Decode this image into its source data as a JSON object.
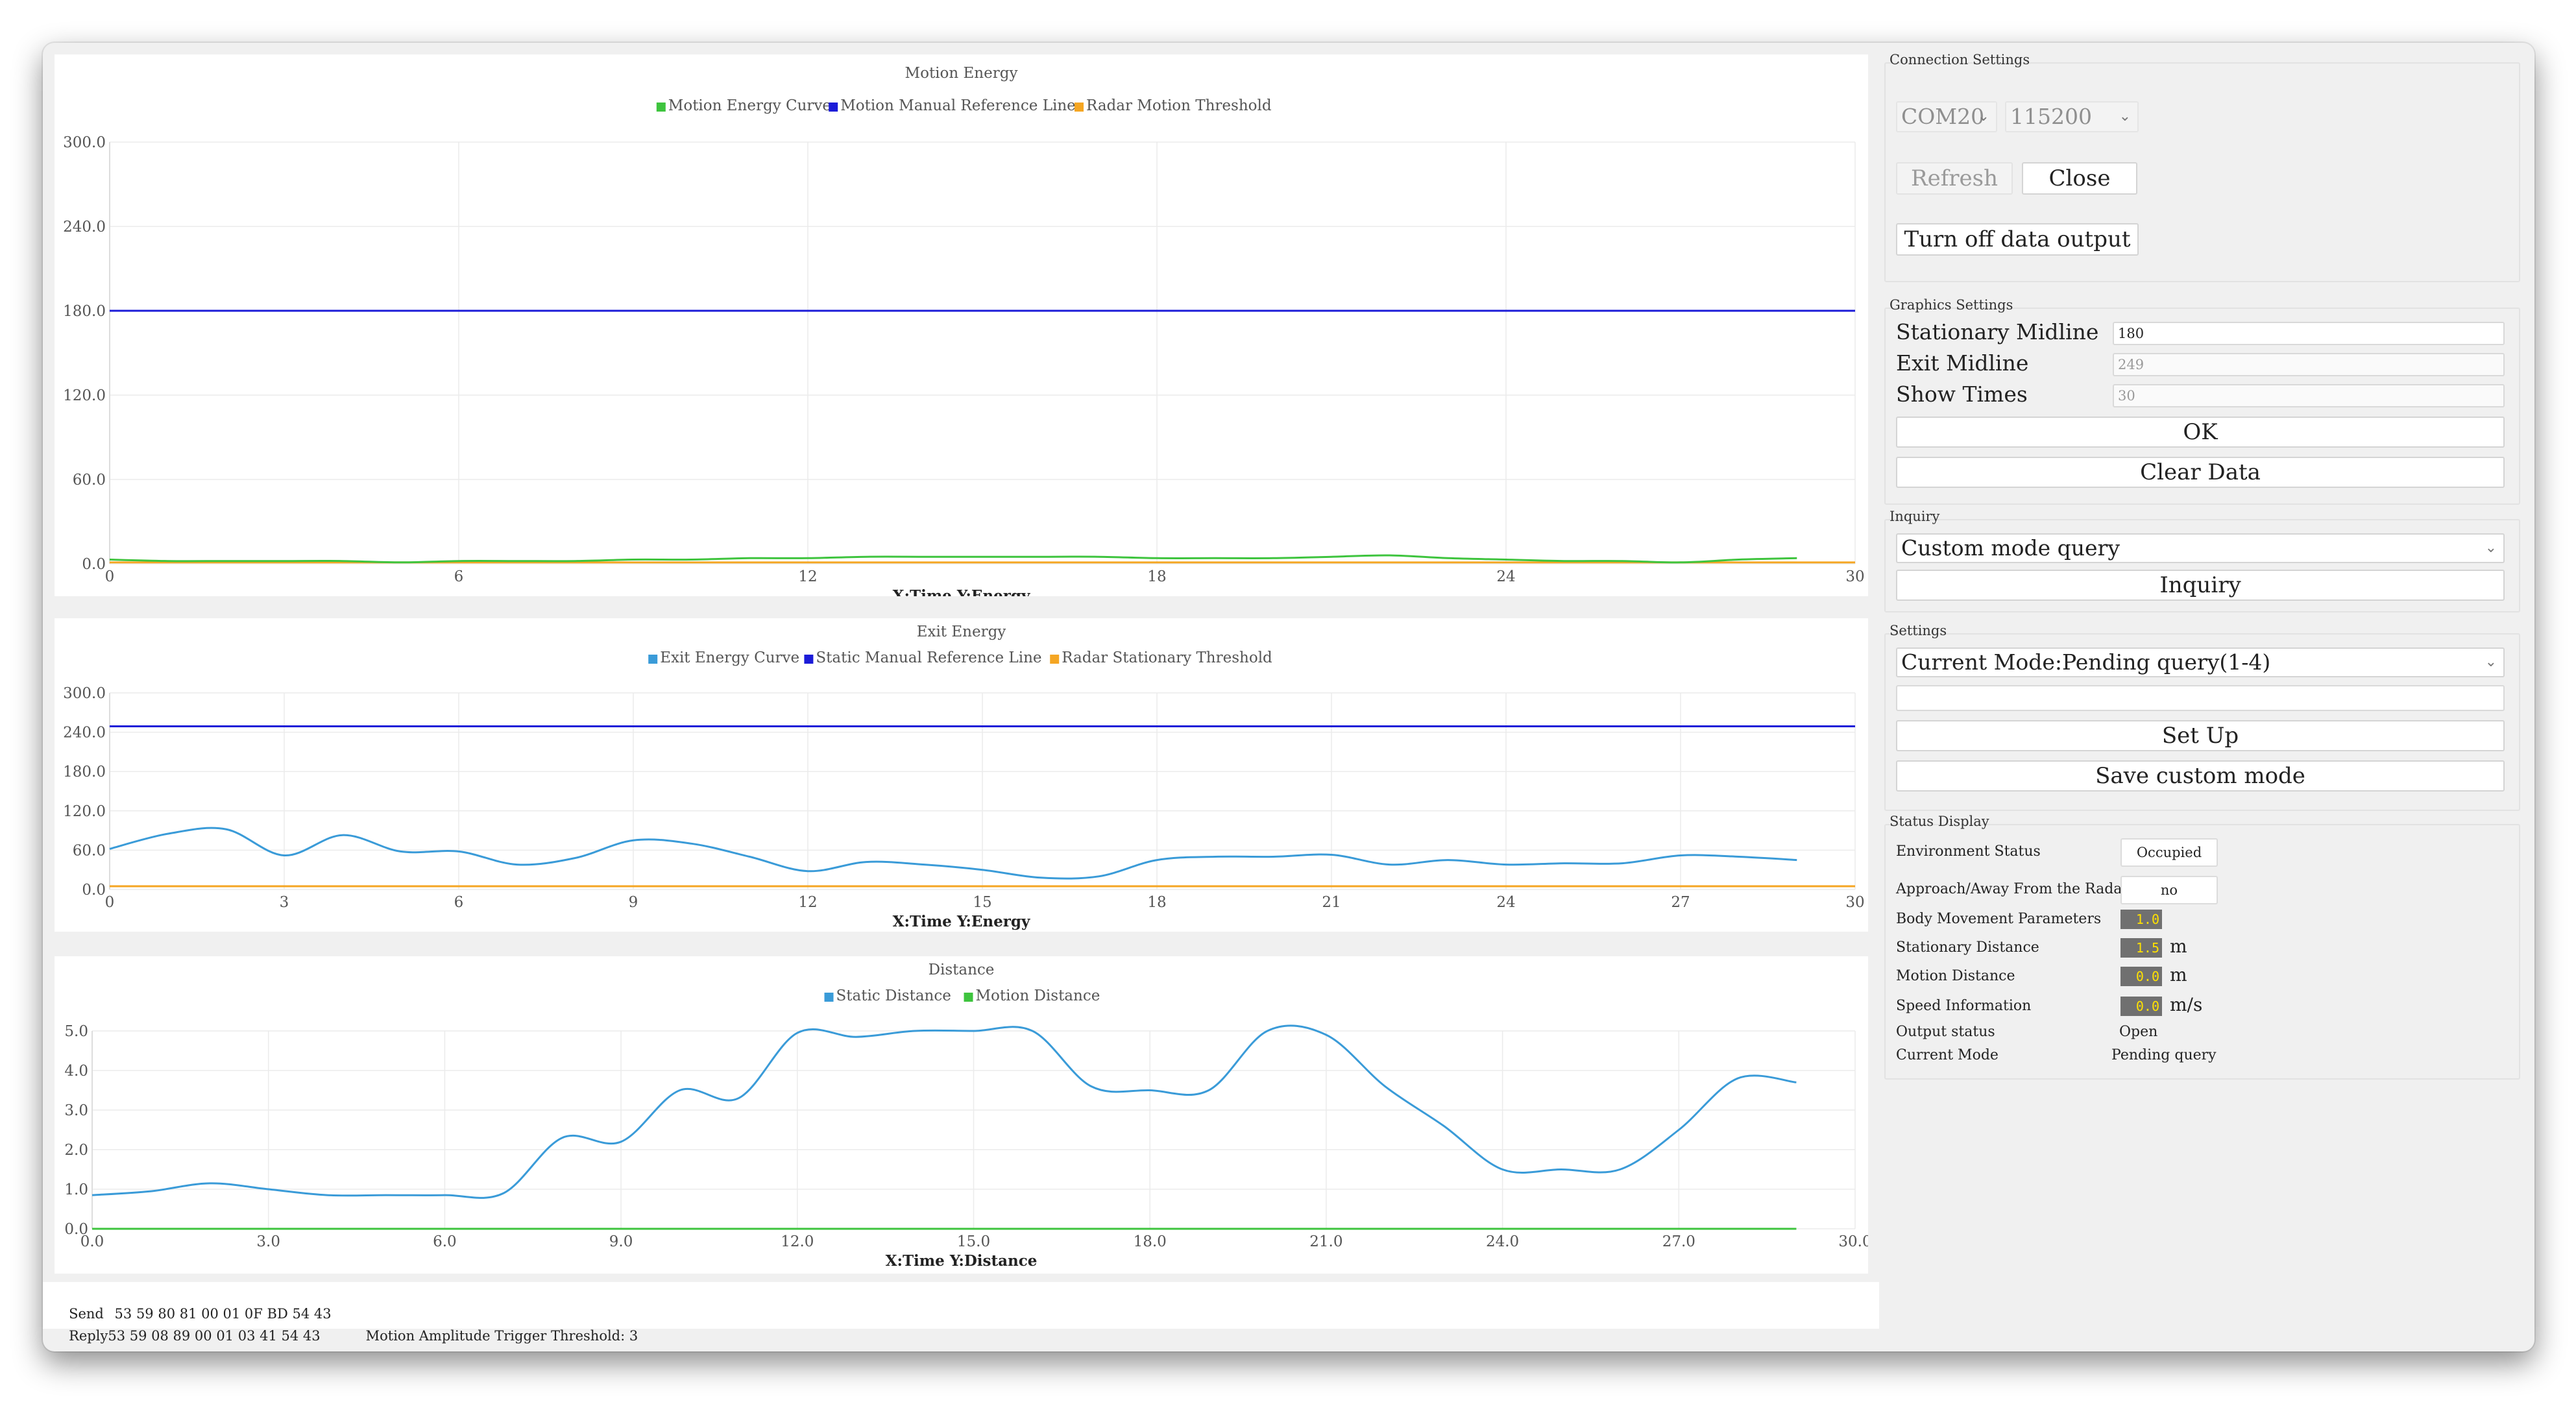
{
  "charts": [
    {
      "title": "Motion Energy",
      "legend": [
        {
          "label": "Motion Energy Curve",
          "color": "#3ec43e"
        },
        {
          "label": "Motion Manual Reference Line",
          "color": "#1c1cd8"
        },
        {
          "label": "Radar Motion Threshold",
          "color": "#f5a623"
        }
      ],
      "axis_label": "X:Time Y:Energy",
      "x_ticks": [
        "0",
        "6",
        "12",
        "18",
        "24",
        "30"
      ],
      "y_ticks": [
        "300.0",
        "240.0",
        "180.0",
        "120.0",
        "60.0",
        "0.0"
      ]
    },
    {
      "title": "Exit Energy",
      "legend": [
        {
          "label": "Exit Energy Curve",
          "color": "#3a9bd8"
        },
        {
          "label": "Static Manual Reference Line",
          "color": "#1c1cd8"
        },
        {
          "label": "Radar Stationary Threshold",
          "color": "#f5a623"
        }
      ],
      "axis_label": "X:Time Y:Energy",
      "x_ticks": [
        "0",
        "3",
        "6",
        "9",
        "12",
        "15",
        "18",
        "21",
        "24",
        "27",
        "30"
      ],
      "y_ticks": [
        "300.0",
        "240.0",
        "180.0",
        "120.0",
        "60.0",
        "0.0"
      ]
    },
    {
      "title": "Distance",
      "legend": [
        {
          "label": "Static Distance",
          "color": "#3a9bd8"
        },
        {
          "label": "Motion Distance",
          "color": "#3ec43e"
        }
      ],
      "axis_label": "X:Time Y:Distance",
      "x_ticks": [
        "0.0",
        "3.0",
        "6.0",
        "9.0",
        "12.0",
        "15.0",
        "18.0",
        "21.0",
        "24.0",
        "27.0",
        "30.0"
      ],
      "y_ticks": [
        "5.0",
        "4.0",
        "3.0",
        "2.0",
        "1.0",
        "0.0"
      ]
    }
  ],
  "chart_data": [
    {
      "type": "line",
      "title": "Motion Energy",
      "xlabel": "X:Time Y:Energy",
      "xlim": [
        0,
        30
      ],
      "ylim": [
        0,
        300
      ],
      "grid": true,
      "legend_position": "top",
      "series": [
        {
          "name": "Motion Energy Curve",
          "color": "#3ec43e",
          "x": [
            0,
            1,
            2,
            3,
            4,
            5,
            6,
            7,
            8,
            9,
            10,
            11,
            12,
            13,
            14,
            15,
            16,
            17,
            18,
            19,
            20,
            21,
            22,
            23,
            24,
            25,
            26,
            27,
            28,
            29
          ],
          "y": [
            3,
            2,
            2,
            2,
            2,
            1,
            2,
            2,
            2,
            3,
            3,
            4,
            4,
            5,
            5,
            5,
            5,
            5,
            4,
            4,
            4,
            5,
            6,
            4,
            3,
            2,
            2,
            1,
            3,
            4
          ]
        },
        {
          "name": "Motion Manual Reference Line",
          "color": "#1c1cd8",
          "x": [
            0,
            30
          ],
          "y": [
            180,
            180
          ]
        },
        {
          "name": "Radar Motion Threshold",
          "color": "#f5a623",
          "x": [
            0,
            30
          ],
          "y": [
            1,
            1
          ]
        }
      ]
    },
    {
      "type": "line",
      "title": "Exit Energy",
      "xlabel": "X:Time Y:Energy",
      "xlim": [
        0,
        30
      ],
      "ylim": [
        0,
        300
      ],
      "grid": true,
      "legend_position": "top",
      "series": [
        {
          "name": "Exit Energy Curve",
          "color": "#3a9bd8",
          "x": [
            0,
            1,
            2,
            3,
            4,
            5,
            6,
            7,
            8,
            9,
            10,
            11,
            12,
            13,
            14,
            15,
            16,
            17,
            18,
            19,
            20,
            21,
            22,
            23,
            24,
            25,
            26,
            27,
            28,
            29
          ],
          "y": [
            62,
            85,
            92,
            52,
            83,
            58,
            58,
            38,
            48,
            75,
            70,
            50,
            28,
            42,
            38,
            30,
            18,
            20,
            45,
            50,
            50,
            53,
            38,
            45,
            38,
            40,
            40,
            52,
            50,
            45
          ]
        },
        {
          "name": "Static Manual Reference Line",
          "color": "#1c1cd8",
          "x": [
            0,
            30
          ],
          "y": [
            249,
            249
          ]
        },
        {
          "name": "Radar Stationary Threshold",
          "color": "#f5a623",
          "x": [
            0,
            30
          ],
          "y": [
            5,
            5
          ]
        }
      ]
    },
    {
      "type": "line",
      "title": "Distance",
      "xlabel": "X:Time Y:Distance",
      "xlim": [
        0,
        30
      ],
      "ylim": [
        0,
        5
      ],
      "grid": true,
      "legend_position": "top",
      "series": [
        {
          "name": "Static Distance",
          "color": "#3a9bd8",
          "x": [
            0,
            1,
            2,
            3,
            4,
            5,
            6,
            7,
            8,
            9,
            10,
            11,
            12,
            13,
            14,
            15,
            16,
            17,
            18,
            19,
            20,
            21,
            22,
            23,
            24,
            25,
            26,
            27,
            28,
            29
          ],
          "y": [
            0.85,
            0.95,
            1.15,
            1.0,
            0.85,
            0.85,
            0.85,
            0.9,
            2.3,
            2.2,
            3.5,
            3.3,
            4.95,
            4.85,
            5.0,
            5.0,
            5.0,
            3.6,
            3.5,
            3.5,
            5.0,
            4.9,
            3.6,
            2.6,
            1.5,
            1.5,
            1.5,
            2.5,
            3.8,
            3.7
          ]
        },
        {
          "name": "Motion Distance",
          "color": "#3ec43e",
          "x": [
            0,
            29
          ],
          "y": [
            0,
            0
          ]
        }
      ]
    }
  ],
  "log": {
    "send_label": "Send",
    "send_hex": "53 59 80 81 00 01 0F BD 54 43",
    "reply_label": "Reply",
    "reply_hex": "53 59 08 89 00 01 03 41 54 43",
    "reply_note": "Motion Amplitude Trigger Threshold: 3"
  },
  "connection": {
    "title": "Connection Settings",
    "port": "COM20",
    "baud": "115200",
    "refresh": "Refresh",
    "close": "Close",
    "toggle_output": "Turn off data output"
  },
  "graphics": {
    "title": "Graphics Settings",
    "stationary_label": "Stationary Midline",
    "stationary_value": "180",
    "exit_label": "Exit Midline",
    "exit_value": "249",
    "times_label": "Show Times",
    "times_value": "30",
    "ok": "OK",
    "clear": "Clear Data"
  },
  "inquiry": {
    "title": "Inquiry",
    "select": "Custom mode query",
    "button": "Inquiry"
  },
  "settings": {
    "title": "Settings",
    "select": "Current Mode:Pending query(1-4)",
    "input": "",
    "set_up": "Set Up",
    "save": "Save custom mode"
  },
  "status": {
    "title": "Status Display",
    "env_label": "Environment Status",
    "env_value": "Occupied",
    "approach_label": "Approach/Away From the Radar",
    "approach_value": "no",
    "body_label": "Body Movement Parameters",
    "body_value": "1.0",
    "stat_dist_label": "Stationary Distance",
    "stat_dist_value": "1.5",
    "stat_dist_unit": "m",
    "motion_dist_label": "Motion Distance",
    "motion_dist_value": "0.0",
    "motion_dist_unit": "m",
    "speed_label": "Speed Information",
    "speed_value": "0.0",
    "speed_unit": "m/s",
    "output_label": "Output status",
    "output_value": "Open",
    "mode_label": "Current Mode",
    "mode_value": "Pending query"
  }
}
